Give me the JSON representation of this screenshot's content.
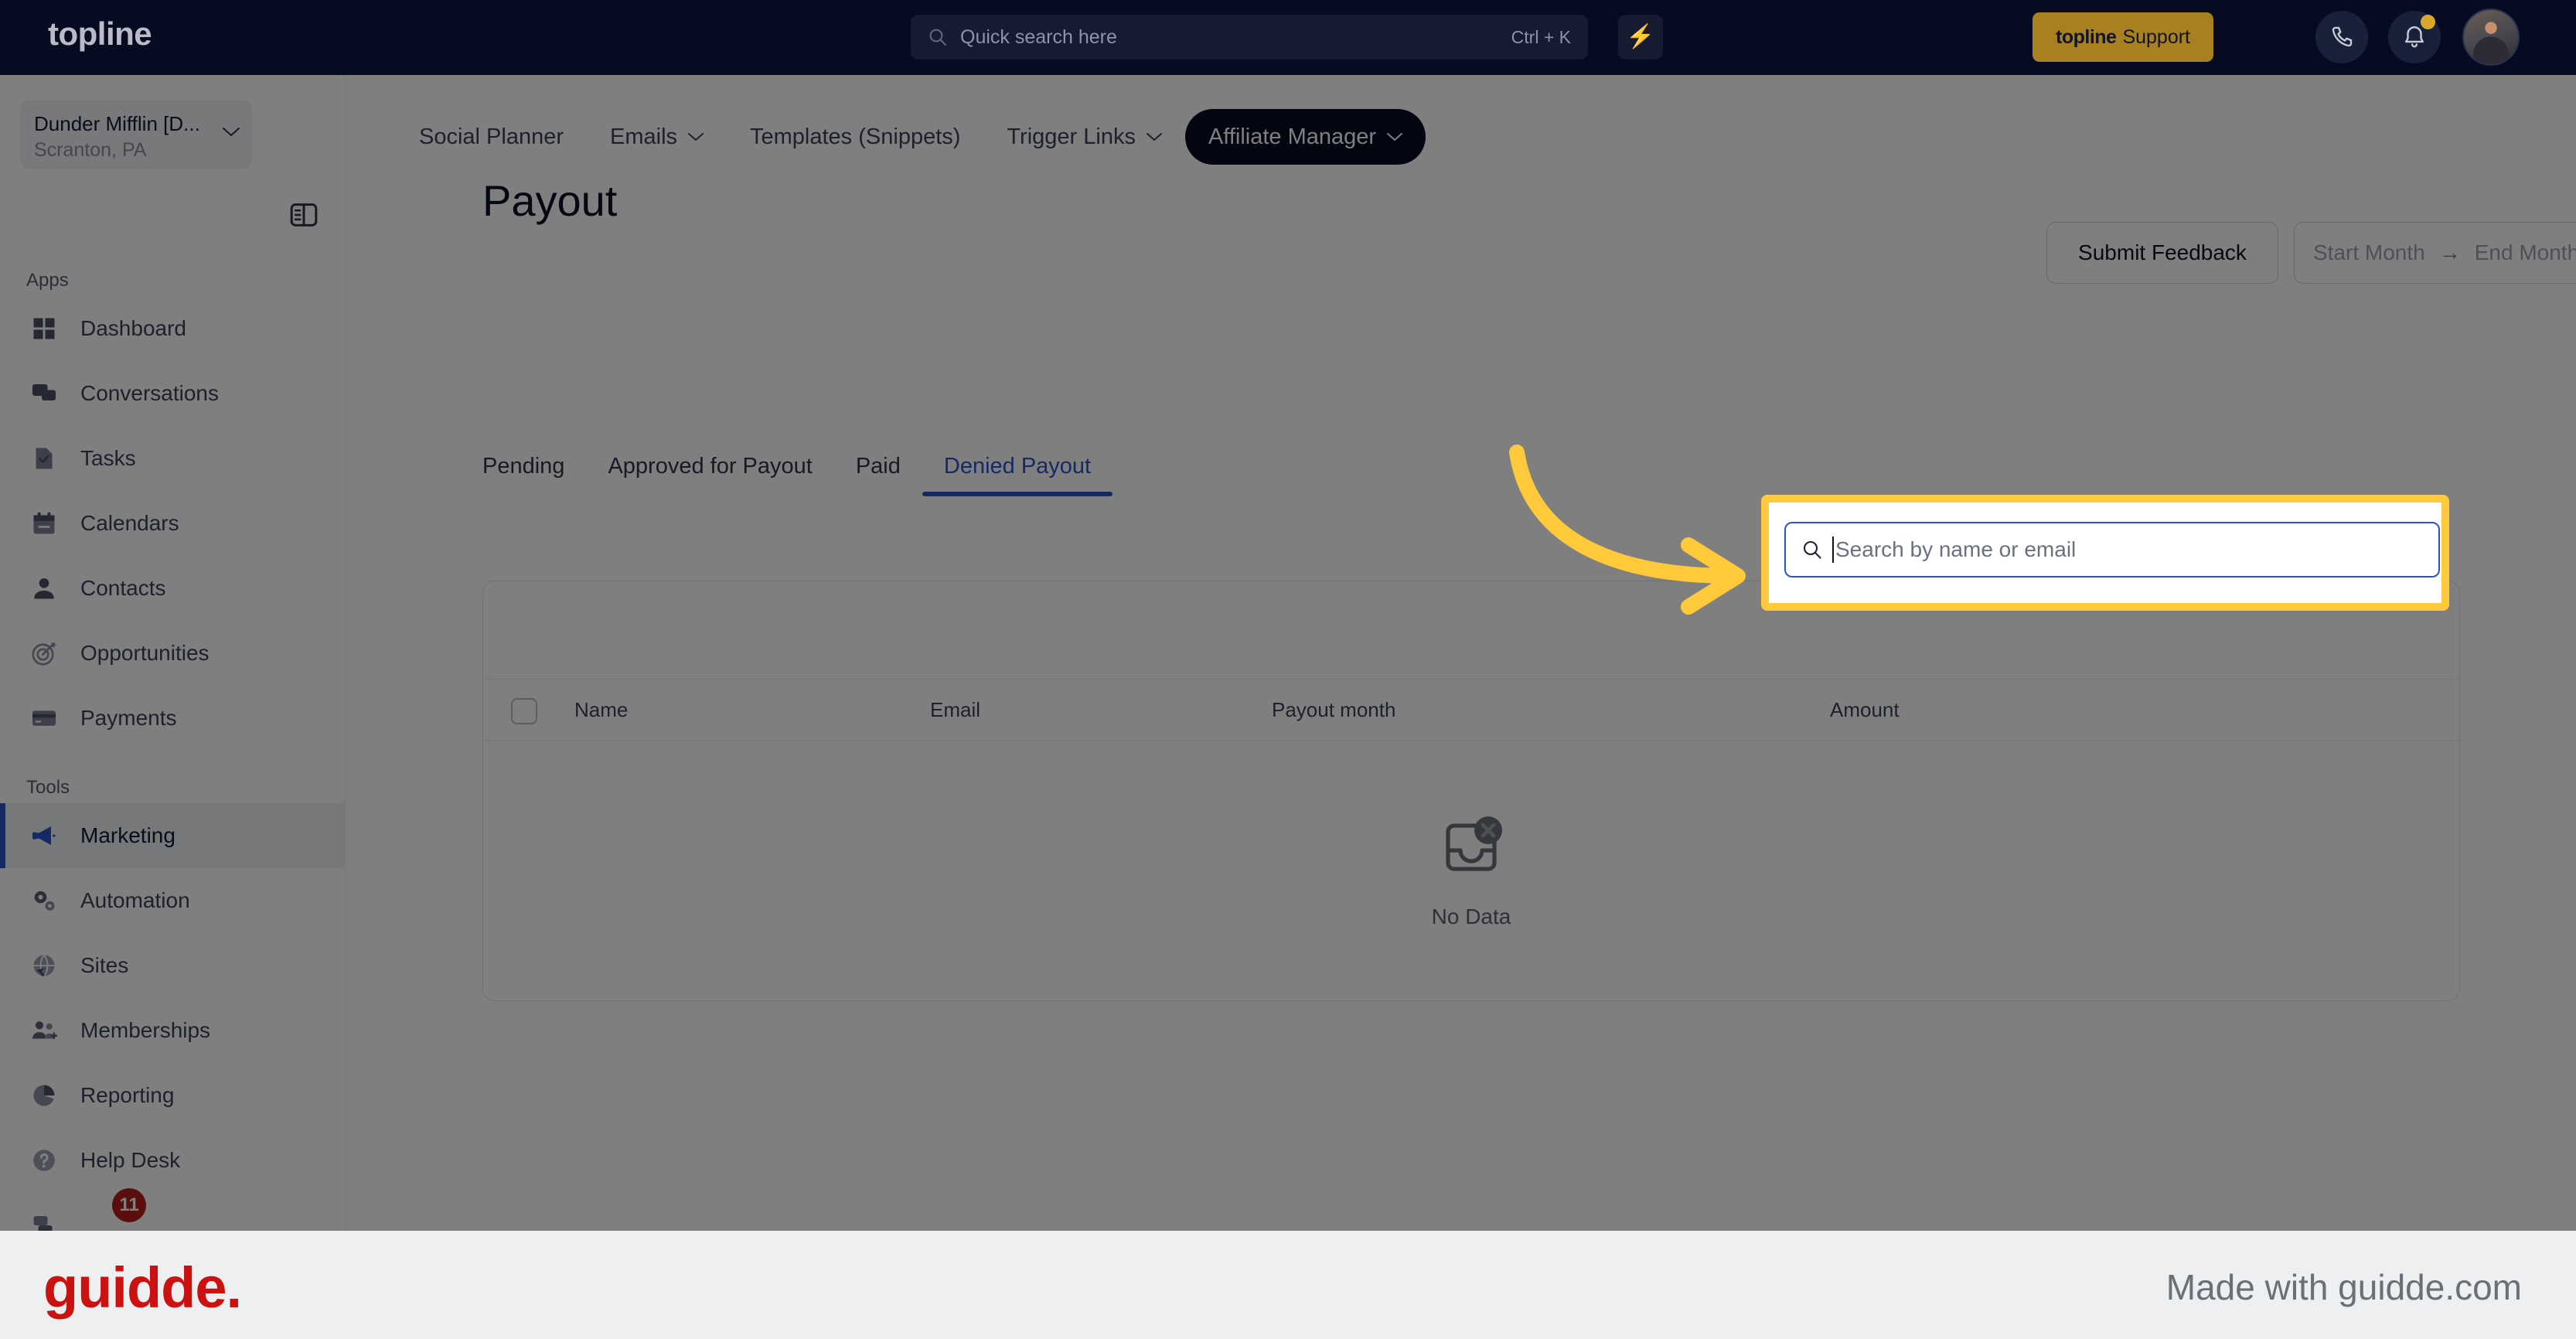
{
  "header": {
    "brand": "topline",
    "quick_search_placeholder": "Quick search here",
    "quick_search_shortcut": "Ctrl + K",
    "bolt_icon": "lightning-bolt-icon",
    "support_brand": "topline",
    "support_label": "Support",
    "phone_icon": "phone-icon",
    "bell_icon": "bell-icon",
    "avatar_icon": "user-avatar"
  },
  "sidebar": {
    "location_name": "Dunder Mifflin [D...",
    "location_sub": "Scranton, PA",
    "collapse_icon": "panel-toggle-icon",
    "sections": [
      {
        "label": "Apps",
        "items": [
          {
            "label": "Dashboard",
            "icon": "dashboard-icon"
          },
          {
            "label": "Conversations",
            "icon": "chat-bubbles-icon"
          },
          {
            "label": "Tasks",
            "icon": "task-check-icon"
          },
          {
            "label": "Calendars",
            "icon": "calendar-icon"
          },
          {
            "label": "Contacts",
            "icon": "person-icon"
          },
          {
            "label": "Opportunities",
            "icon": "target-icon"
          },
          {
            "label": "Payments",
            "icon": "credit-card-icon"
          }
        ]
      },
      {
        "label": "Tools",
        "items": [
          {
            "label": "Marketing",
            "icon": "megaphone-icon",
            "active": true
          },
          {
            "label": "Automation",
            "icon": "gears-icon"
          },
          {
            "label": "Sites",
            "icon": "globe-cursor-icon"
          },
          {
            "label": "Memberships",
            "icon": "people-plus-icon"
          },
          {
            "label": "Reporting",
            "icon": "pie-chart-icon"
          },
          {
            "label": "Help Desk",
            "icon": "question-circle-icon"
          }
        ]
      }
    ],
    "badge_count": "11"
  },
  "subnav": {
    "items": [
      {
        "label": "Social Planner",
        "caret": false
      },
      {
        "label": "Emails",
        "caret": true
      },
      {
        "label": "Templates (Snippets)",
        "caret": false
      },
      {
        "label": "Trigger Links",
        "caret": true
      },
      {
        "label": "Affiliate Manager",
        "caret": true,
        "active": true
      }
    ]
  },
  "page": {
    "title": "Payout",
    "submit_feedback_label": "Submit Feedback",
    "start_month_placeholder": "Start Month",
    "range_arrow": "→",
    "end_month_placeholder": "End Month",
    "calendar_icon": "calendar-icon",
    "download_icon": "download-icon"
  },
  "payout_tabs": [
    {
      "label": "Pending",
      "active": false
    },
    {
      "label": "Approved for Payout",
      "active": false
    },
    {
      "label": "Paid",
      "active": false
    },
    {
      "label": "Denied Payout",
      "active": true
    }
  ],
  "table": {
    "search_placeholder": "Search by name or email",
    "search_icon": "search-icon",
    "select_all_checkbox": "select-all-checkbox",
    "columns": [
      "Name",
      "Email",
      "Payout month",
      "Amount"
    ],
    "rows": [],
    "empty_text": "No Data",
    "empty_icon": "inbox-x-icon"
  },
  "annotation": {
    "arrow_icon": "curved-arrow-icon",
    "highlight_color": "#ffc93c"
  },
  "footer": {
    "logo": "guidde.",
    "made_with": "Made with guidde.com"
  },
  "colors": {
    "header_bg": "#060b22",
    "accent_blue": "#2c52c9",
    "support_gold": "#a8801f",
    "highlight_yellow": "#ffc93c",
    "badge_red": "#b71c1c",
    "guidde_red": "#cc1111"
  }
}
